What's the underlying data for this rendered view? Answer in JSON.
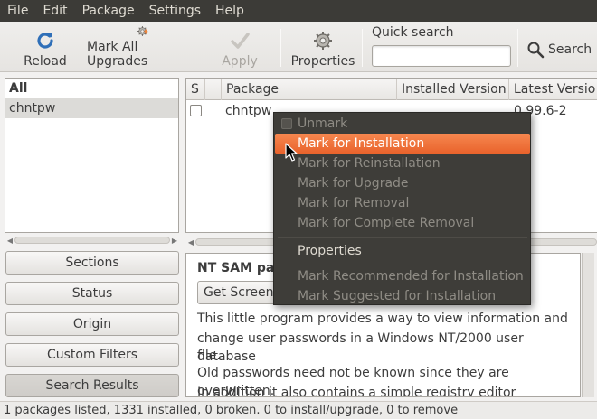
{
  "menubar": [
    "File",
    "Edit",
    "Package",
    "Settings",
    "Help"
  ],
  "toolbar": {
    "reload": "Reload",
    "mark_all": "Mark All Upgrades",
    "apply": "Apply",
    "properties": "Properties",
    "quick_search_label": "Quick search",
    "quick_search_value": "",
    "search": "Search"
  },
  "filters": {
    "items": [
      "All",
      "chntpw"
    ]
  },
  "left_buttons": [
    "Sections",
    "Status",
    "Origin",
    "Custom Filters",
    "Search Results"
  ],
  "package_table": {
    "columns": [
      "S",
      "",
      "Package",
      "Installed Version",
      "Latest Versio"
    ],
    "rows": [
      {
        "package": "chntpw",
        "installed": "",
        "latest": "0.99.6-2"
      }
    ]
  },
  "details": {
    "title": "NT SAM pas",
    "screenshot_button": "Get Screenshot",
    "description": [
      "This little program provides a way to view information and",
      "change user passwords in a Windows NT/2000 user database",
      "file.",
      "Old passwords need not be known since they are overwritten.",
      "In addition it also contains a simple registry editor"
    ]
  },
  "status_bar": "1 packages listed, 1331 installed, 0 broken. 0 to install/upgrade, 0 to remove",
  "context_menu": {
    "items": [
      "Unmark",
      "Mark for Installation",
      "Mark for Reinstallation",
      "Mark for Upgrade",
      "Mark for Removal",
      "Mark for Complete Removal",
      "Properties",
      "Mark Recommended for Installation",
      "Mark Suggested for Installation"
    ]
  },
  "colors": {
    "menubar_bg": "#3c3b37",
    "highlight": "#f07746",
    "context_bg": "#3e3d39"
  }
}
